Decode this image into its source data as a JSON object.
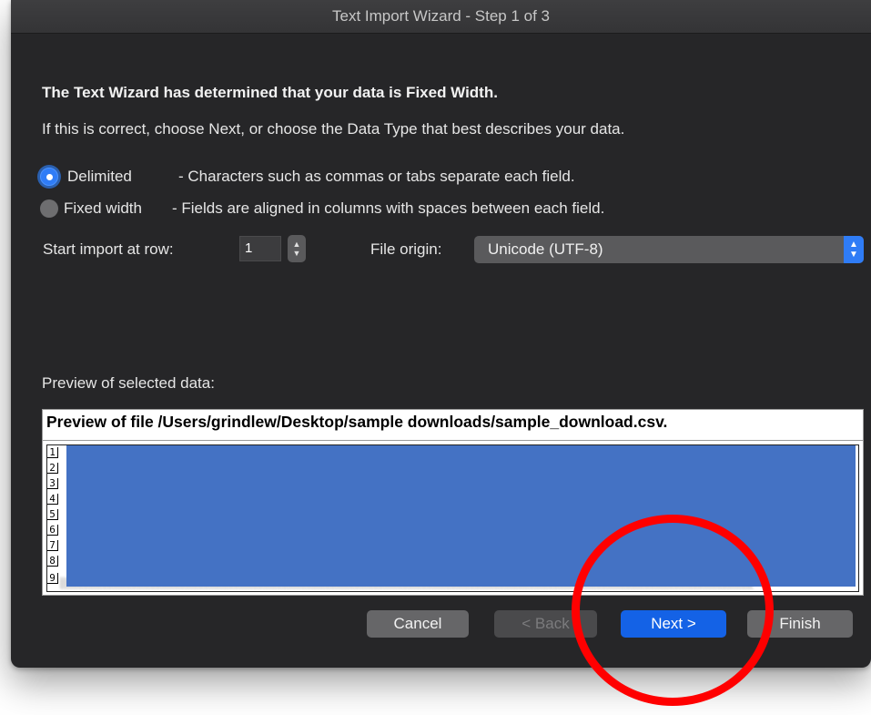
{
  "window": {
    "title": "Text Import Wizard - Step 1 of 3"
  },
  "intro": {
    "heading": "The Text Wizard has determined that your data is Fixed Width.",
    "instruction": "If this is correct, choose Next, or choose the Data Type that best describes your data."
  },
  "data_type": {
    "selected": "Delimited",
    "options": [
      {
        "label": "Delimited",
        "description": "- Characters such as commas or tabs separate each field."
      },
      {
        "label": "Fixed width",
        "description": "- Fields are aligned in columns with spaces between each field."
      }
    ]
  },
  "start_row": {
    "label": "Start import at row:",
    "value": "1",
    "stepper_up": "▲",
    "stepper_down": "▼"
  },
  "file_origin": {
    "label": "File origin:",
    "value": "Unicode (UTF-8)",
    "arrow_up": "▲",
    "arrow_down": "▼"
  },
  "preview": {
    "label": "Preview of selected data:",
    "header": "Preview of file /Users/grindlew/Desktop/sample downloads/sample_download.csv.",
    "row_numbers": [
      "1",
      "2",
      "3",
      "4",
      "5",
      "6",
      "7",
      "8",
      "9"
    ]
  },
  "buttons": {
    "cancel": "Cancel",
    "back": "< Back",
    "next": "Next >",
    "finish": "Finish"
  },
  "colors": {
    "accent": "#1462e6",
    "selection": "#4472c4",
    "annotation": "#ff0000",
    "window_bg": "#262628"
  }
}
